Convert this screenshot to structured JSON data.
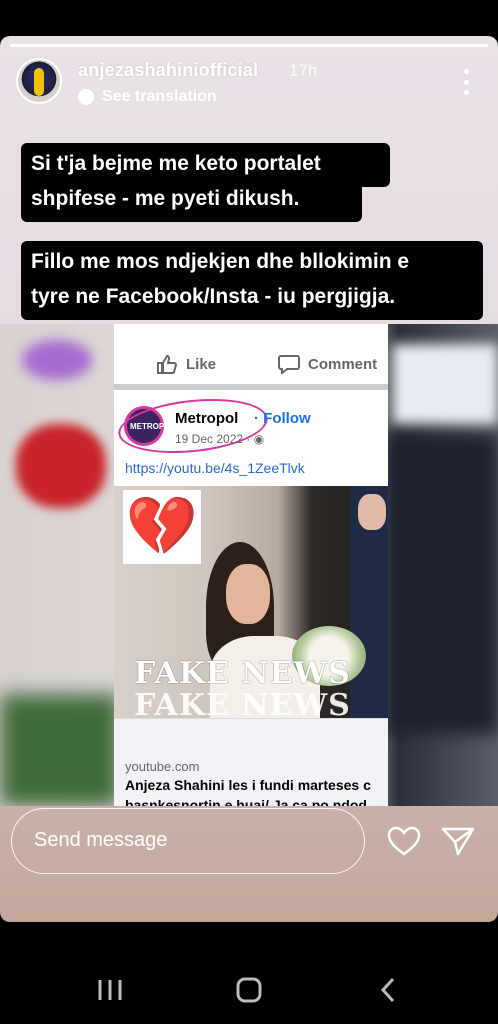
{
  "story": {
    "progress": 1.0,
    "username": "anjezashahiniofficial",
    "time_ago": "17h",
    "see_translation": "See translation",
    "caption_lines_1": [
      "Si t'ja bejme me keto portalet",
      "shpifese - me pyeti dikush."
    ],
    "caption_lines_2": [
      "Fillo me mos ndjekjen dhe bllokimin e",
      "tyre ne Facebook/Insta - iu pergjigja."
    ]
  },
  "fb_post": {
    "like_label": "Like",
    "comment_label": "Comment",
    "page_name": "Metropol",
    "page_avatar_text": "METROPOL",
    "follow_label": "Follow",
    "date": "19 Dec 2022 · ",
    "link": "https://youtu.be/4s_1ZeeTlvk",
    "overlay_text": "FAKE NEWS",
    "link_domain": "youtube.com",
    "link_title_1": "Anjeza Shahini les i fundi marteses c",
    "link_title_2": "basnkesnortin e huaj/ Ja ca po ndod"
  },
  "footer": {
    "send_placeholder": "Send message"
  },
  "icons": [
    "avatar",
    "more-icon",
    "globe-icon",
    "like-icon",
    "comment-icon",
    "heart-icon",
    "send-icon",
    "recents-icon",
    "home-icon",
    "back-icon"
  ],
  "colors": {
    "accent_link": "#2d6ad2",
    "follow": "#1b74e4",
    "circle_mark": "#d63aa0"
  }
}
